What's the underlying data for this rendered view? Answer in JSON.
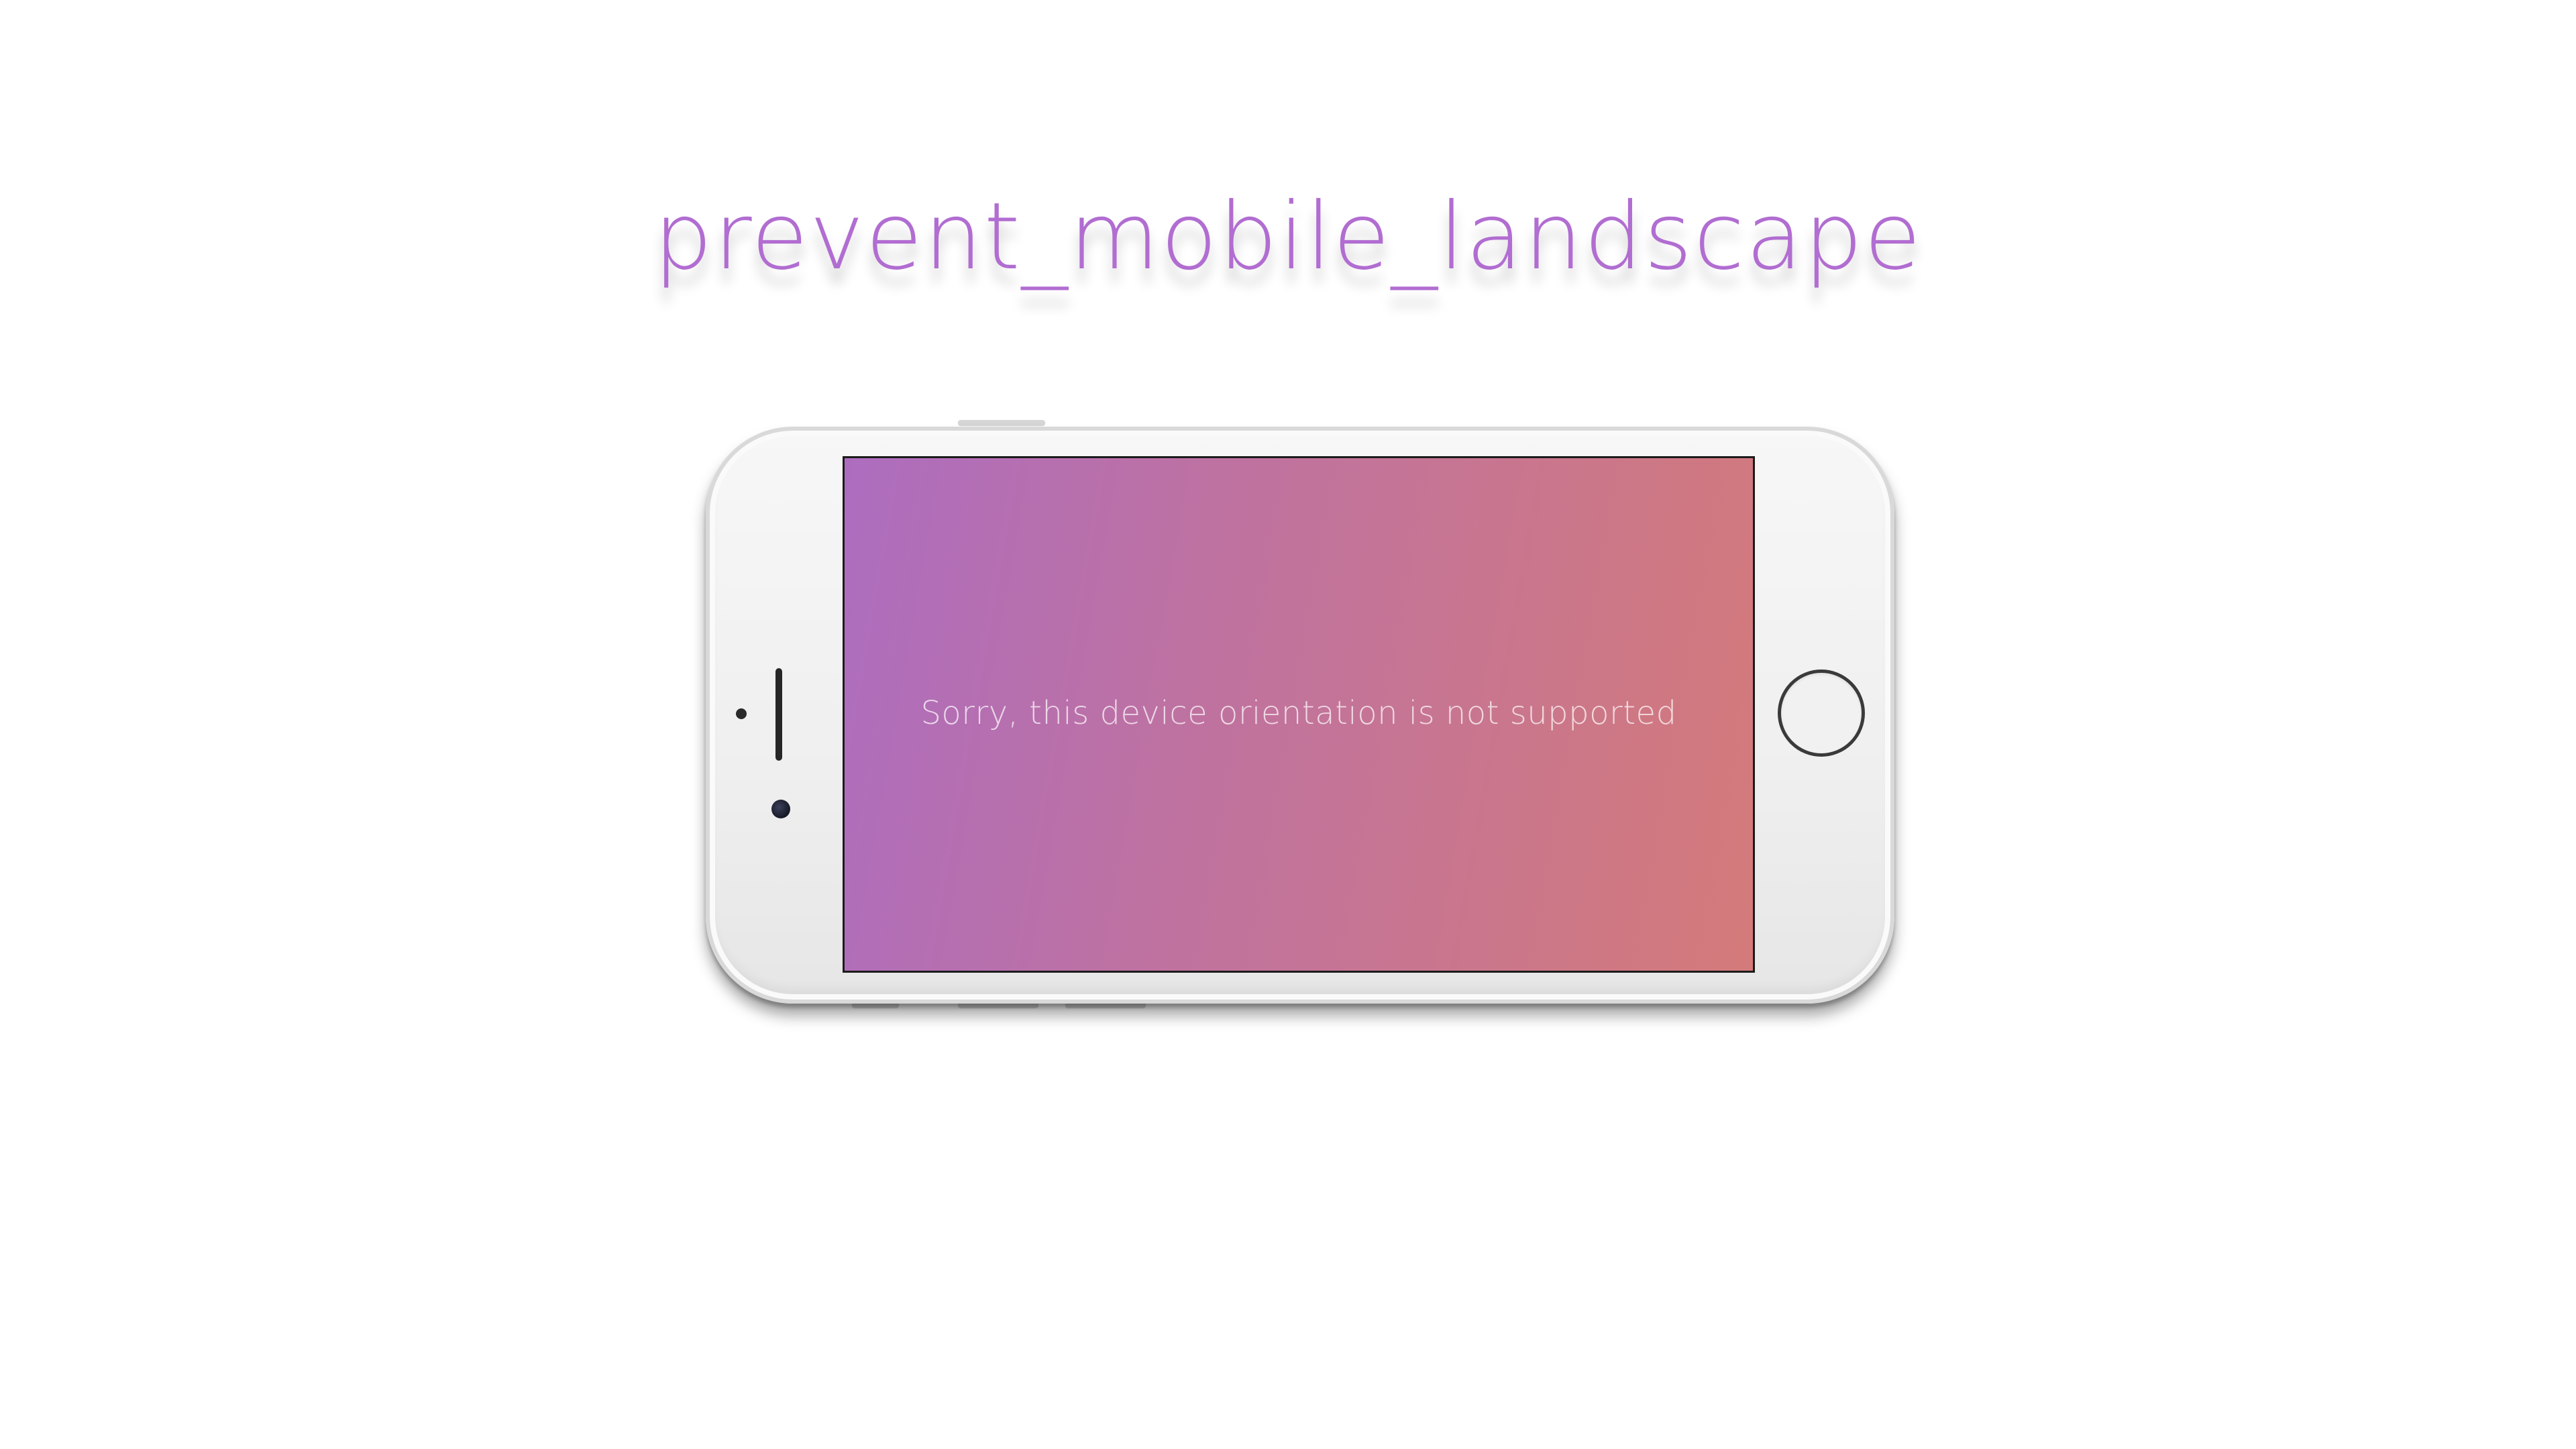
{
  "page": {
    "title": "prevent_mobile_landscape"
  },
  "phone": {
    "screen_message": "Sorry, this device orientation is not supported",
    "icons": {
      "home_button": "home-button",
      "earpiece": "earpiece-speaker",
      "front_camera": "front-camera"
    }
  },
  "colors": {
    "title": "#b16dd1",
    "screen_gradient_start": "#ad6dbf",
    "screen_gradient_end": "#d47a7a",
    "background": "#ffffff"
  }
}
